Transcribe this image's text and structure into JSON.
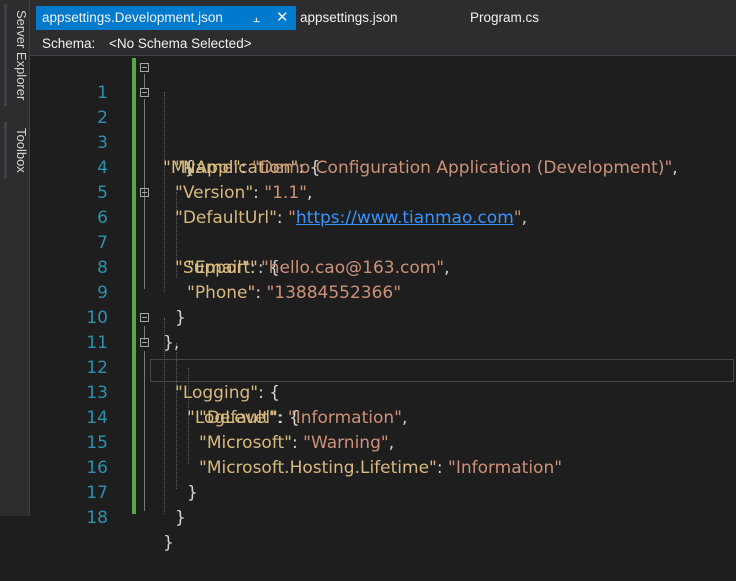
{
  "side_panel": {
    "server_explorer": "Server Explorer",
    "toolbox": "Toolbox"
  },
  "tabs": [
    {
      "label": "appsettings.Development.json",
      "active": true
    },
    {
      "label": "appsettings.json",
      "active": false
    },
    {
      "label": "Program.cs",
      "active": false
    }
  ],
  "tab_icons": {
    "pin": "pin-icon",
    "close": "close-icon"
  },
  "schema": {
    "label": "Schema:",
    "value": "<No Schema Selected>"
  },
  "editor": {
    "lines": [
      {
        "n": "1"
      },
      {
        "n": "2"
      },
      {
        "n": "3"
      },
      {
        "n": "4"
      },
      {
        "n": "5"
      },
      {
        "n": "6"
      },
      {
        "n": "7"
      },
      {
        "n": "8"
      },
      {
        "n": "9"
      },
      {
        "n": "10"
      },
      {
        "n": "11"
      },
      {
        "n": "12"
      },
      {
        "n": "13"
      },
      {
        "n": "14"
      },
      {
        "n": "15"
      },
      {
        "n": "16"
      },
      {
        "n": "17"
      },
      {
        "n": "18"
      }
    ],
    "tokens": {
      "open_brace": "{",
      "close_brace": "}",
      "close_brace_comma": "},",
      "my_application_key": "\"MyApplication\"",
      "name_key": "\"Name\"",
      "name_val": "\"Demo Configuration Application (Development)\"",
      "version_key": "\"Version\"",
      "version_val": "\"1.1\"",
      "defaulturl_key": "\"DefaultUrl\"",
      "defaulturl_q1": "\"",
      "defaulturl_link": "https://www.tianmao.com",
      "defaulturl_q2": "\"",
      "support_key": "\"Support\"",
      "email_key": "\"Email\"",
      "email_val": "\"hello.cao@163.com\"",
      "phone_key": "\"Phone\"",
      "phone_val": "\"13884552366\"",
      "logging_key": "\"Logging\"",
      "loglevel_key": "\"LogLevel\"",
      "default_key": "\"Default\"",
      "default_val": "\"Information\"",
      "microsoft_key": "\"Microsoft\"",
      "microsoft_val": "\"Warning\"",
      "hosting_key": "\"Microsoft.Hosting.Lifetime\"",
      "hosting_val": "\"Information\"",
      "colon_brace": ": {",
      "colon": ": ",
      "comma": ","
    }
  },
  "colors": {
    "accent": "#007acc",
    "key": "#d7ba7d",
    "string": "#ce9178",
    "link": "#3794ff",
    "line_number": "#2b91af",
    "modified_bar": "#57a64a"
  }
}
